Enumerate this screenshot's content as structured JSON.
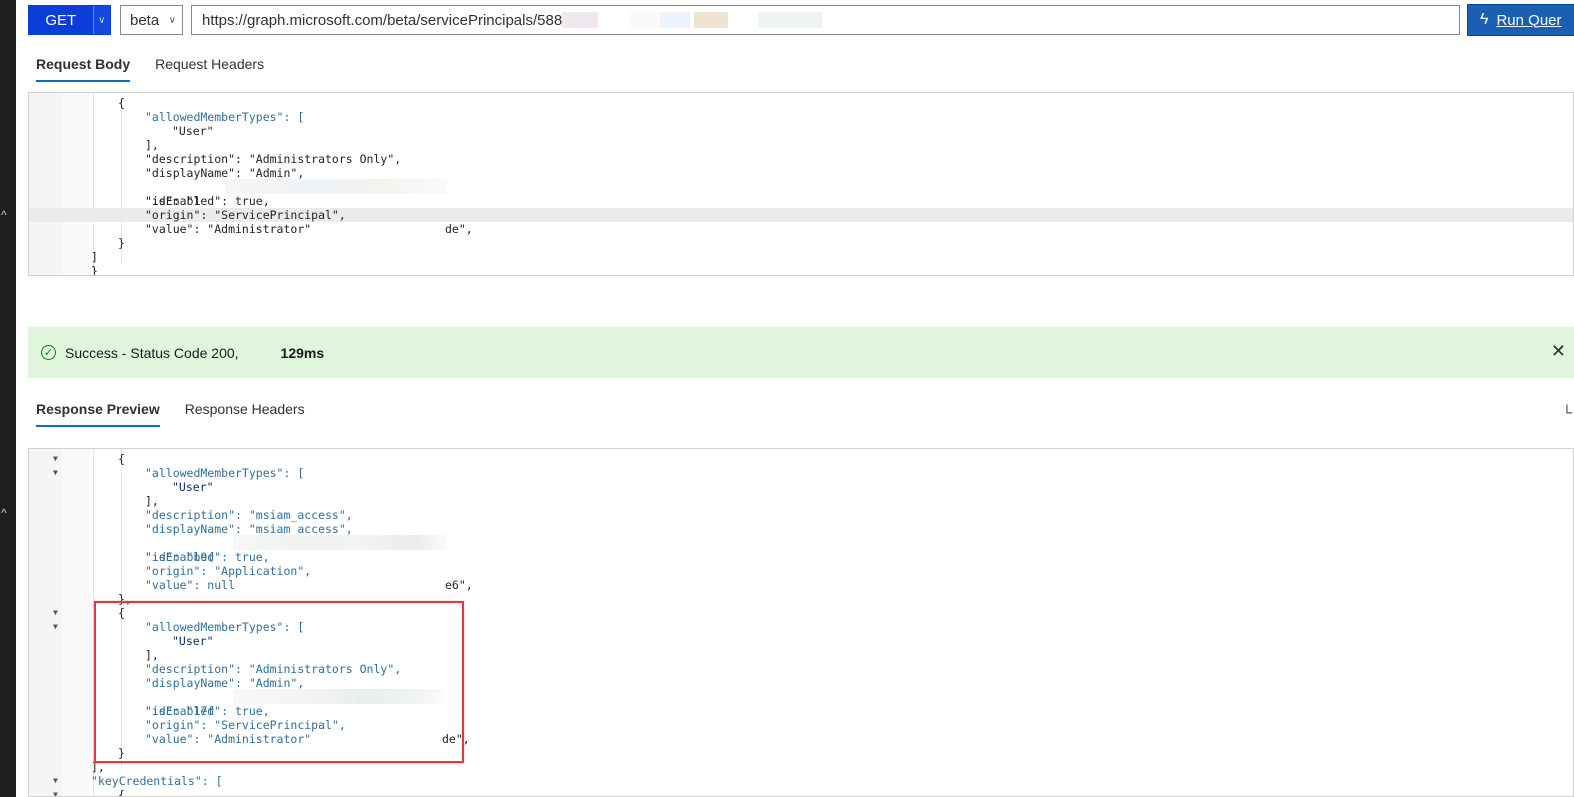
{
  "query": {
    "method": "GET",
    "version": "beta",
    "url": "https://graph.microsoft.com/beta/servicePrincipals/588",
    "run_label": "Run Quer"
  },
  "request_tabs": [
    "Request Body",
    "Request Headers"
  ],
  "request_body_lines": [
    "{",
    "\"allowedMemberTypes\": [",
    "\"User\"",
    "],",
    "\"description\": \"Administrators Only\",",
    "\"displayName\": \"Admin\",",
    "\"id\": \"1",
    "de\",",
    "\"isEnabled\": true,",
    "\"origin\": \"ServicePrincipal\",",
    "\"value\": \"Administrator\"",
    "}",
    "]",
    "}"
  ],
  "status": {
    "text": "Success - Status Code 200,",
    "duration": "129ms",
    "close_icon": "close-icon",
    "icon": "check-circle-icon",
    "color": "#dff6dd"
  },
  "response_tabs": [
    "Response Preview",
    "Response Headers"
  ],
  "response_lines": [
    "{",
    "\"allowedMemberTypes\": [",
    "\"User\"",
    "],",
    "\"description\": \"msiam_access\",",
    "\"displayName\": \"msiam_access\",",
    "\"id\": \"b9(",
    "e6\",",
    "\"isEnabled\": true,",
    "\"origin\": \"Application\",",
    "\"value\": null",
    "},",
    "{",
    "\"allowedMemberTypes\": [",
    "\"User\"",
    "],",
    "\"description\": \"Administrators Only\",",
    "\"displayName\": \"Admin\",",
    "\"id\": \"17f",
    "de\",",
    "\"isEnabled\": true,",
    "\"origin\": \"ServicePrincipal\",",
    "\"value\": \"Administrator\"",
    "}",
    "],",
    "\"keyCredentials\": [",
    "{"
  ],
  "accent": "#0f6cbd",
  "run_button_color": "#1a5fb4",
  "method_color": "#0b3ed8",
  "highlight_color": "#e0393e"
}
